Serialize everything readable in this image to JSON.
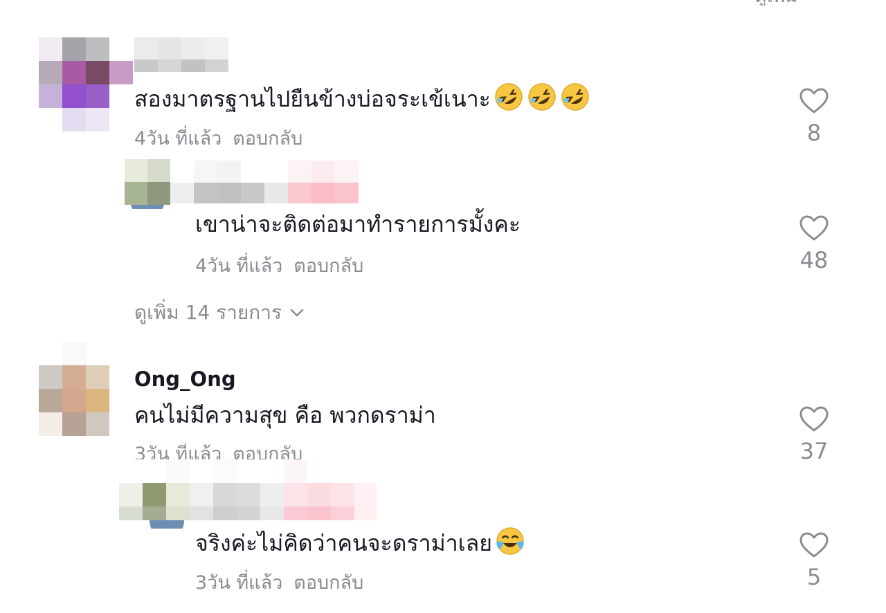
{
  "top_cut_text": "ดูเพิ่ม",
  "comments": [
    {
      "text": "สองมาตรฐานไปยืนข้างบ่อจระเข้เนาะ",
      "emoji": [
        "rolling-on-floor-laughing-icon",
        "rolling-on-floor-laughing-icon",
        "rolling-on-floor-laughing-icon"
      ],
      "time": "4วัน ที่แล้ว",
      "reply": "ตอบกลับ",
      "likes": "8"
    },
    {
      "text": "เขาน่าจะติดต่อมาทำรายการมั้งคะ",
      "time": "4วัน ที่แล้ว",
      "reply": "ตอบกลับ",
      "likes": "48"
    },
    {
      "username": "Ong_Ong",
      "text": "คนไม่มีความสุข คือ พวกดราม่า",
      "time": "3วัน ที่แล้ว",
      "reply": "ตอบกลับ",
      "likes": "37"
    },
    {
      "text": "จริงค่ะไม่คิดว่าคนจะดราม่าเลย",
      "emoji": [
        "face-with-tears-of-joy-icon"
      ],
      "time": "3วัน ที่แล้ว",
      "reply": "ตอบกลับ",
      "likes": "5"
    }
  ],
  "view_more": "ดูเพิ่ม 14 รายการ",
  "colors": {
    "primary_text": "#161823",
    "secondary_text": "#8a8b91",
    "background": "#ffffff"
  }
}
